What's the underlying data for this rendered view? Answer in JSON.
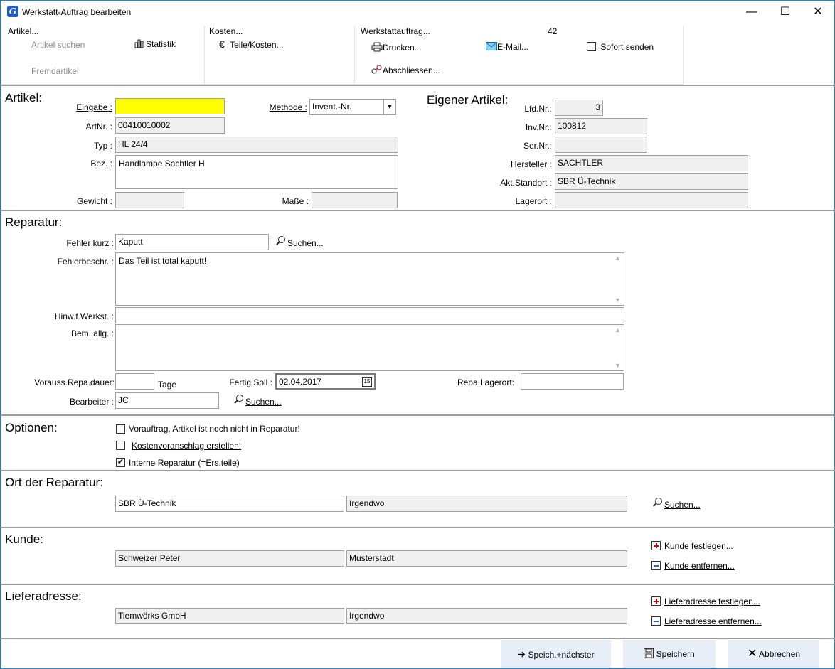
{
  "window": {
    "title": "Werkstatt-Auftrag bearbeiten",
    "icon": "app-logo-icon",
    "minimize": "—",
    "maximize": "☐",
    "close": "✕"
  },
  "ribbon": {
    "artikel": {
      "title": "Artikel...",
      "search": "Artikel suchen",
      "stat": "Statistik",
      "foreign": "Fremdartikel"
    },
    "kosten": {
      "title": "Kosten...",
      "parts": "Teile/Kosten..."
    },
    "werkstatt": {
      "title": "Werkstattauftrag...",
      "number": "42",
      "print": "Drucken...",
      "email": "E-Mail...",
      "send": "Sofort senden",
      "close": "Abschliessen..."
    }
  },
  "artikel": {
    "title": "Artikel:",
    "eingabe_label": "Eingabe :",
    "eingabe_value": "",
    "methode_label": "Methode :",
    "methode_value": "Invent.-Nr.",
    "artnr_label": "ArtNr. :",
    "artnr_value": "00410010002",
    "typ_label": "Typ :",
    "typ_value": "HL 24/4",
    "bez_label": "Bez. :",
    "bez_value": "Handlampe Sachtler H",
    "gewicht_label": "Gewicht :",
    "gewicht_value": "",
    "masse_label": "Maße :",
    "masse_value": ""
  },
  "eigener": {
    "title": "Eigener Artikel:",
    "lfd_label": "Lfd.Nr.:",
    "lfd_value": "3",
    "inv_label": "Inv.Nr.:",
    "inv_value": "100812",
    "ser_label": "Ser.Nr.:",
    "ser_value": "",
    "hersteller_label": "Hersteller :",
    "hersteller_value": "SACHTLER",
    "standort_label": "Akt.Standort :",
    "standort_value": "SBR Ü-Technik",
    "lagerort_label": "Lagerort :",
    "lagerort_value": ""
  },
  "reparatur": {
    "title": "Reparatur:",
    "fehler_kurz_label": "Fehler kurz :",
    "fehler_kurz_value": "Kaputt",
    "suchen": "Suchen...",
    "fehlerbeschr_label": "Fehlerbeschr. :",
    "fehlerbeschr_value": "Das Teil ist total kaputt!",
    "hinw_label": "Hinw.f.Werkst. :",
    "hinw_value": "",
    "bem_label": "Bem. allg. :",
    "bem_value": "",
    "dauer_label": "Vorauss.Repa.dauer:",
    "dauer_value": "",
    "tage": "Tage",
    "fertig_label": "Fertig Soll :",
    "fertig_value": "02.04.2017",
    "lagerort_label": "Repa.Lagerort:",
    "lagerort_value": "",
    "bearbeiter_label": "Bearbeiter :",
    "bearbeiter_value": "JC",
    "suchen2": "Suchen..."
  },
  "optionen": {
    "title": "Optionen:",
    "opt1": "Vorauftrag, Artikel ist noch nicht in Reparatur!",
    "opt1_checked": false,
    "opt2": "Kostenvoranschlag erstellen!",
    "opt2_checked": false,
    "opt3": "Interne Reparatur (=Ers.teile)",
    "opt3_checked": true
  },
  "ort": {
    "title": "Ort der Reparatur:",
    "name": "SBR Ü-Technik",
    "city": "Irgendwo",
    "suchen": "Suchen..."
  },
  "kunde": {
    "title": "Kunde:",
    "name": "Schweizer Peter",
    "city": "Musterstadt",
    "set": "Kunde festlegen...",
    "remove": "Kunde entfernen..."
  },
  "liefer": {
    "title": "Lieferadresse:",
    "name": "Tiemwörks GmbH",
    "city": "Irgendwo",
    "set": "Lieferadresse festlegen...",
    "remove": "Lieferadresse entfernen..."
  },
  "footer": {
    "save_next": "Speich.+nächster",
    "save": "Speichern",
    "cancel": "Abbrechen"
  }
}
